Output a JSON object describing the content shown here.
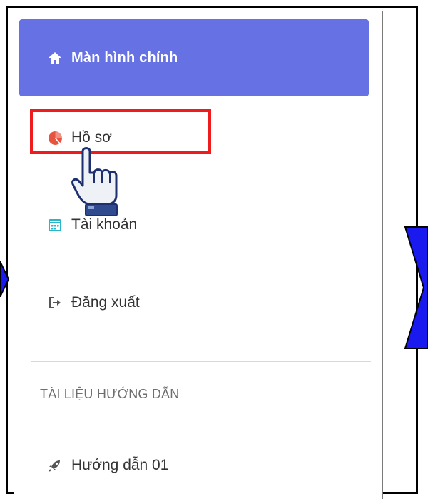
{
  "sidebar": {
    "home": {
      "label": "Màn hình chính",
      "icon": "home-icon"
    },
    "items": [
      {
        "label": "Hồ sơ",
        "icon": "pie-chart-icon",
        "icon_color": "#e8533f"
      },
      {
        "label": "Tài khoản",
        "icon": "calendar-icon",
        "icon_color": "#29b6c8"
      },
      {
        "label": "Đăng xuất",
        "icon": "logout-icon",
        "icon_color": "#555555"
      }
    ],
    "section_title": "TÀI LIỆU HƯỚNG DẪN",
    "guide_item": {
      "label": "Hướng dẫn 01",
      "icon": "rocket-icon"
    }
  },
  "colors": {
    "accent": "#6672e4",
    "highlight": "#ee1c1c",
    "chevron": "#1a1aee"
  }
}
